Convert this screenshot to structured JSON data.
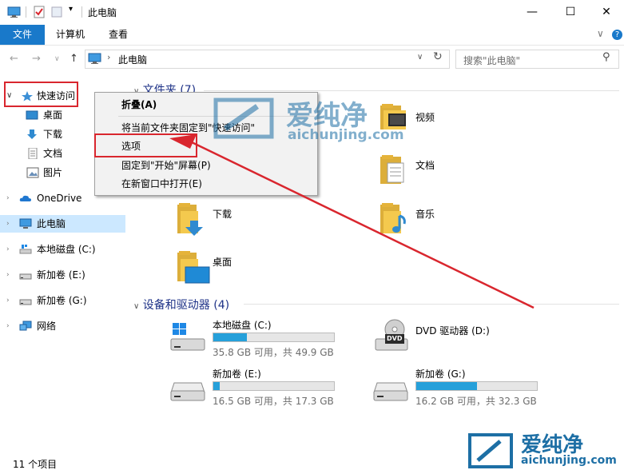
{
  "window": {
    "title": "此电脑",
    "controls": [
      "minimize-icon",
      "maximize-icon",
      "close-icon"
    ]
  },
  "ribbon": {
    "tabs": [
      "文件",
      "计算机",
      "查看"
    ],
    "expand_glyph": "∨",
    "help_glyph": "?"
  },
  "address": {
    "path_root": "此电脑",
    "search_placeholder": "搜索\"此电脑\""
  },
  "nav": {
    "quick_access": "快速访问",
    "quick_items": [
      "桌面",
      "下载",
      "文档",
      "图片"
    ],
    "onedrive": "OneDrive",
    "this_pc": "此电脑",
    "drive_c": "本地磁盘 (C:)",
    "drive_e": "新加卷 (E:)",
    "drive_g": "新加卷 (G:)",
    "network": "网络"
  },
  "content": {
    "folders_header": "文件夹 (7)",
    "folders": {
      "video": "视频",
      "docs": "文档",
      "downloads": "下载",
      "music": "音乐",
      "desktop": "桌面"
    },
    "devices_header": "设备和驱动器 (4)",
    "drives": [
      {
        "name": "本地磁盘 (C:)",
        "free": "35.8 GB 可用，共 49.9 GB",
        "used_fraction": 0.28
      },
      {
        "name": "DVD 驱动器 (D:)",
        "free": "",
        "used_fraction": null
      },
      {
        "name": "新加卷 (E:)",
        "free": "16.5 GB 可用，共 17.3 GB",
        "used_fraction": 0.05
      },
      {
        "name": "新加卷 (G:)",
        "free": "16.2 GB 可用，共 32.3 GB",
        "used_fraction": 0.5
      }
    ],
    "dvd_badge": "DVD"
  },
  "context_menu": {
    "items": [
      "折叠(A)",
      "将当前文件夹固定到\"快速访问\"",
      "选项",
      "固定到\"开始\"屏幕(P)",
      "在新窗口中打开(E)"
    ]
  },
  "status_bar": {
    "count": "11 个项目"
  },
  "watermark": {
    "brand_cn": "爱纯净",
    "brand_url": "aichunjing.com"
  },
  "colors": {
    "accent": "#1979ca",
    "selection": "#cce8ff",
    "annotation_red": "#d9262e",
    "drive_fill": "#26a0da"
  }
}
